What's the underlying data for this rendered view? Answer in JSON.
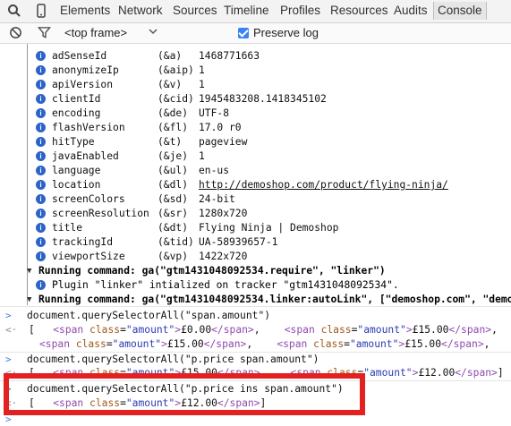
{
  "toolbar": {
    "tabs": [
      "Elements",
      "Network",
      "Sources",
      "Timeline",
      "Profiles",
      "Resources",
      "Audits",
      "Console"
    ],
    "active_tab": "Console"
  },
  "filterbar": {
    "frame_select": "<top frame>",
    "preserve_log_label": "Preserve log",
    "preserve_log_checked": true
  },
  "fields": [
    {
      "key": "adSenseId",
      "abbr": "(&a)",
      "value": "1468771663"
    },
    {
      "key": "anonymizeIp",
      "abbr": "(&aip)",
      "value": "1"
    },
    {
      "key": "apiVersion",
      "abbr": "(&v)",
      "value": "1"
    },
    {
      "key": "clientId",
      "abbr": "(&cid)",
      "value": "1945483208.1418345102"
    },
    {
      "key": "encoding",
      "abbr": "(&de)",
      "value": "UTF-8"
    },
    {
      "key": "flashVersion",
      "abbr": "(&fl)",
      "value": "17.0 r0"
    },
    {
      "key": "hitType",
      "abbr": "(&t)",
      "value": "pageview"
    },
    {
      "key": "javaEnabled",
      "abbr": "(&je)",
      "value": "1"
    },
    {
      "key": "language",
      "abbr": "(&ul)",
      "value": "en-us"
    },
    {
      "key": "location",
      "abbr": "(&dl)",
      "value": "http://demoshop.com/product/flying-ninja/"
    },
    {
      "key": "screenColors",
      "abbr": "(&sd)",
      "value": "24-bit"
    },
    {
      "key": "screenResolution",
      "abbr": "(&sr)",
      "value": "1280x720"
    },
    {
      "key": "title",
      "abbr": "(&dt)",
      "value": "Flying Ninja | Demoshop"
    },
    {
      "key": "trackingId",
      "abbr": "(&tid)",
      "value": "UA-58939657-1"
    },
    {
      "key": "viewportSize",
      "abbr": "(&vp)",
      "value": "1422x720"
    }
  ],
  "log": {
    "run1": "Running command: ga(\"gtm1431048092534.require\", \"linker\")",
    "plugin": "Plugin \"linker\" intialized on tracker \"gtm1431048092534\".",
    "run2": "Running command: ga(\"gtm1431048092534.linker:autoLink\", [\"demoshop.com\", \"demo"
  },
  "commands": {
    "c1": "document.querySelectorAll(\"span.amount\")",
    "c2": "document.querySelectorAll(\"p.price span.amount\")",
    "c3": "document.querySelectorAll(\"p.price ins span.amount\")"
  },
  "results": {
    "r1_open": "[",
    "span_open": "<span",
    "attr_name": "class",
    "attr_val": "\"amount\"",
    "span_close": "</span>",
    "amt0": "£0.00",
    "amt15": "£15.00",
    "amt12": "£12.00",
    "cut": "<s",
    "close": "]"
  }
}
